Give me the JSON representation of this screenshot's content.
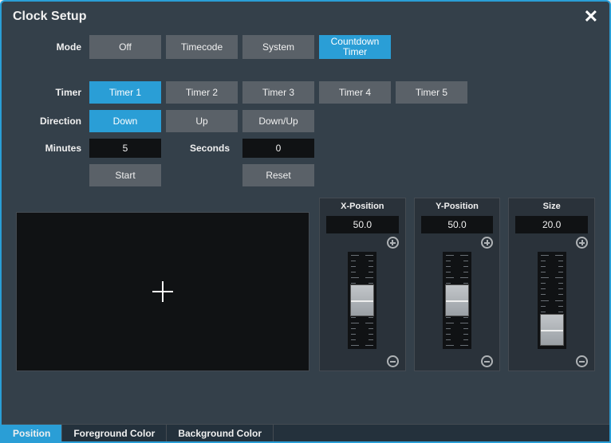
{
  "title": "Clock Setup",
  "labels": {
    "mode": "Mode",
    "timer": "Timer",
    "direction": "Direction",
    "minutes": "Minutes",
    "seconds": "Seconds"
  },
  "mode": {
    "options": [
      "Off",
      "Timecode",
      "System",
      "Countdown Timer"
    ],
    "selected": "Countdown Timer"
  },
  "timer": {
    "options": [
      "Timer 1",
      "Timer 2",
      "Timer 3",
      "Timer 4",
      "Timer 5"
    ],
    "selected": "Timer 1"
  },
  "direction": {
    "options": [
      "Down",
      "Up",
      "Down/Up"
    ],
    "selected": "Down"
  },
  "minutes": "5",
  "seconds": "0",
  "actions": {
    "start": "Start",
    "reset": "Reset"
  },
  "sliders": {
    "x": {
      "label": "X-Position",
      "value": "50.0",
      "pos": 0.5
    },
    "y": {
      "label": "Y-Position",
      "value": "50.0",
      "pos": 0.5
    },
    "size": {
      "label": "Size",
      "value": "20.0",
      "pos": 0.2
    }
  },
  "tabs": {
    "options": [
      "Position",
      "Foreground Color",
      "Background Color"
    ],
    "selected": "Position"
  },
  "colors": {
    "accent": "#2a9ed6",
    "panel": "#34404a"
  }
}
